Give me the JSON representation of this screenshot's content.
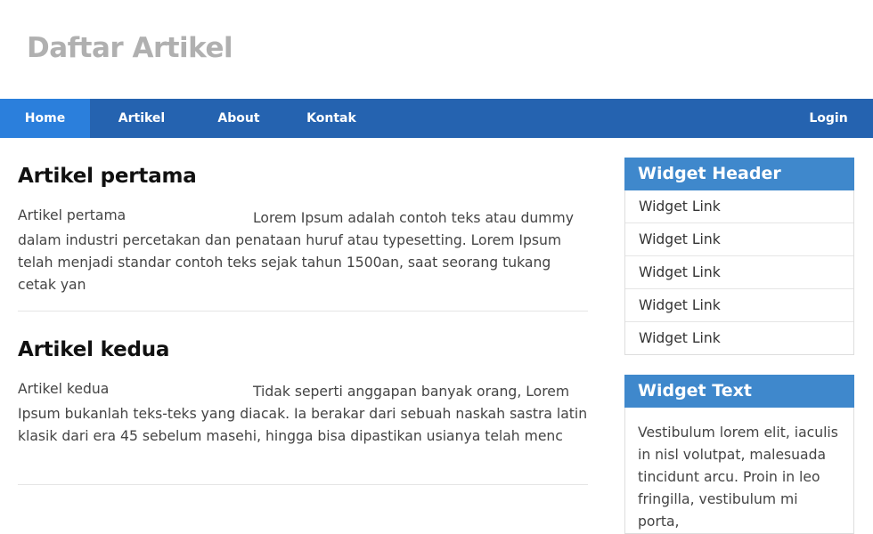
{
  "site": {
    "title": "Daftar Artikel"
  },
  "nav": {
    "home": "Home",
    "artikel": "Artikel",
    "about": "About",
    "kontak": "Kontak",
    "login": "Login"
  },
  "articles": [
    {
      "title": "Artikel pertama",
      "image_alt": "Artikel pertama",
      "excerpt": "Lorem Ipsum adalah contoh teks atau dummy dalam industri percetakan dan penataan huruf atau typesetting. Lorem Ipsum telah menjadi standar contoh teks sejak tahun 1500an, saat seorang tukang cetak yan"
    },
    {
      "title": "Artikel kedua",
      "image_alt": "Artikel kedua",
      "excerpt": "Tidak seperti anggapan banyak orang, Lorem Ipsum bukanlah teks-teks yang diacak. Ia berakar dari sebuah naskah sastra latin klasik dari era 45 sebelum masehi, hingga bisa dipastikan usianya telah menc"
    }
  ],
  "sidebar": {
    "widget_header": "Widget Header",
    "links": [
      "Widget Link",
      "Widget Link",
      "Widget Link",
      "Widget Link",
      "Widget Link"
    ],
    "widget_text_header": "Widget Text",
    "widget_text": "Vestibulum lorem elit, iaculis in nisl volutpat, malesuada tincidunt arcu. Proin in leo fringilla, vestibulum mi porta,"
  },
  "colors": {
    "nav_bg": "#2563b0",
    "nav_active": "#2b7fdc",
    "widget_header_bg": "#3f88cc",
    "title_gray": "#b0b0b0"
  }
}
